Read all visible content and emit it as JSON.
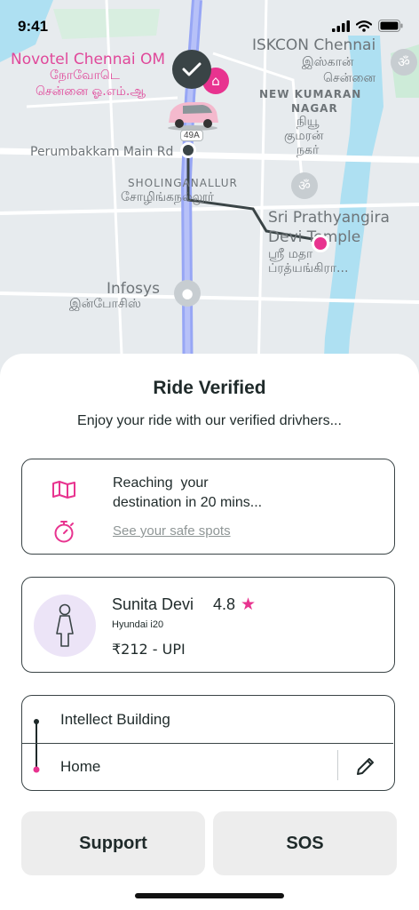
{
  "status_bar": {
    "time": "9:41"
  },
  "map": {
    "labels": {
      "novotel": "Novotel Chennai OM",
      "novotel_ta1": "நோவோடெ",
      "novotel_ta2": "சென்னை ஓ.எம்.ஆ",
      "iskcon": "ISKCON Chennai",
      "iskcon_ta1": "இஸ்கான்",
      "iskcon_ta2": "சென்னை",
      "new_kumaran": "NEW KUMARAN",
      "nagar": "NAGAR",
      "nagar_ta1": "நியூ",
      "nagar_ta2": "குமரன்",
      "nagar_ta3": "நகர்",
      "perumbakkam": "Perumbakkam Main Rd",
      "sholinganallur": "SHOLINGANALLUR",
      "sholinganallur_ta": "சோழிங்கநல்லூர்",
      "temple1": "Sri Prathyangira",
      "temple2": "Devi Temple",
      "temple_ta1": "ஸ்ரீ மதா",
      "temple_ta2": "ப்ரத்யங்கிரா...",
      "infosys": "Infosys",
      "infosys_ta": "இன்போசிஸ்"
    },
    "route_tag": "49A"
  },
  "sheet": {
    "title": "Ride Verified",
    "subtitle": "Enjoy your ride with our verified drivhers...",
    "eta": {
      "line1": "Reaching  your",
      "line2": "destination in 20 mins...",
      "safe_spots_link": "See your safe spots"
    },
    "driver": {
      "name": "Sunita Devi",
      "rating": "4.8",
      "car": "Hyundai i20",
      "fare": "₹212 - UPI"
    },
    "trip": {
      "from": "Intellect Building",
      "to": "Home"
    },
    "buttons": {
      "support": "Support",
      "sos": "SOS"
    }
  },
  "colors": {
    "accent": "#e8338f",
    "dark": "#3a4446",
    "avatar_bg": "#ece4f7",
    "button_bg": "#ededed"
  },
  "icons": [
    "signal-icon",
    "wifi-icon",
    "battery-icon",
    "check-icon",
    "car-icon",
    "map-icon",
    "timer-icon",
    "star-icon",
    "driver-avatar-icon",
    "pencil-icon"
  ]
}
